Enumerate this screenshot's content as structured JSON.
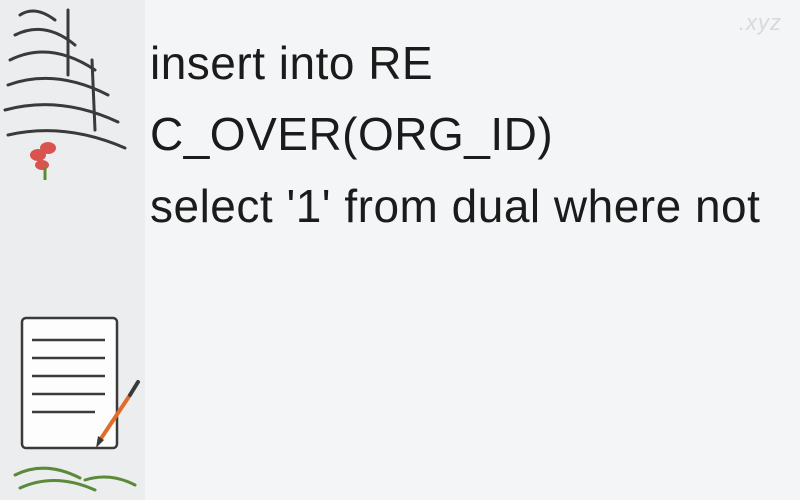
{
  "watermark": ".xyz",
  "content": {
    "line1": "insert into RE",
    "line2": "C_OVER(ORG_ID)",
    "line3": " select '1' from dual where not"
  }
}
